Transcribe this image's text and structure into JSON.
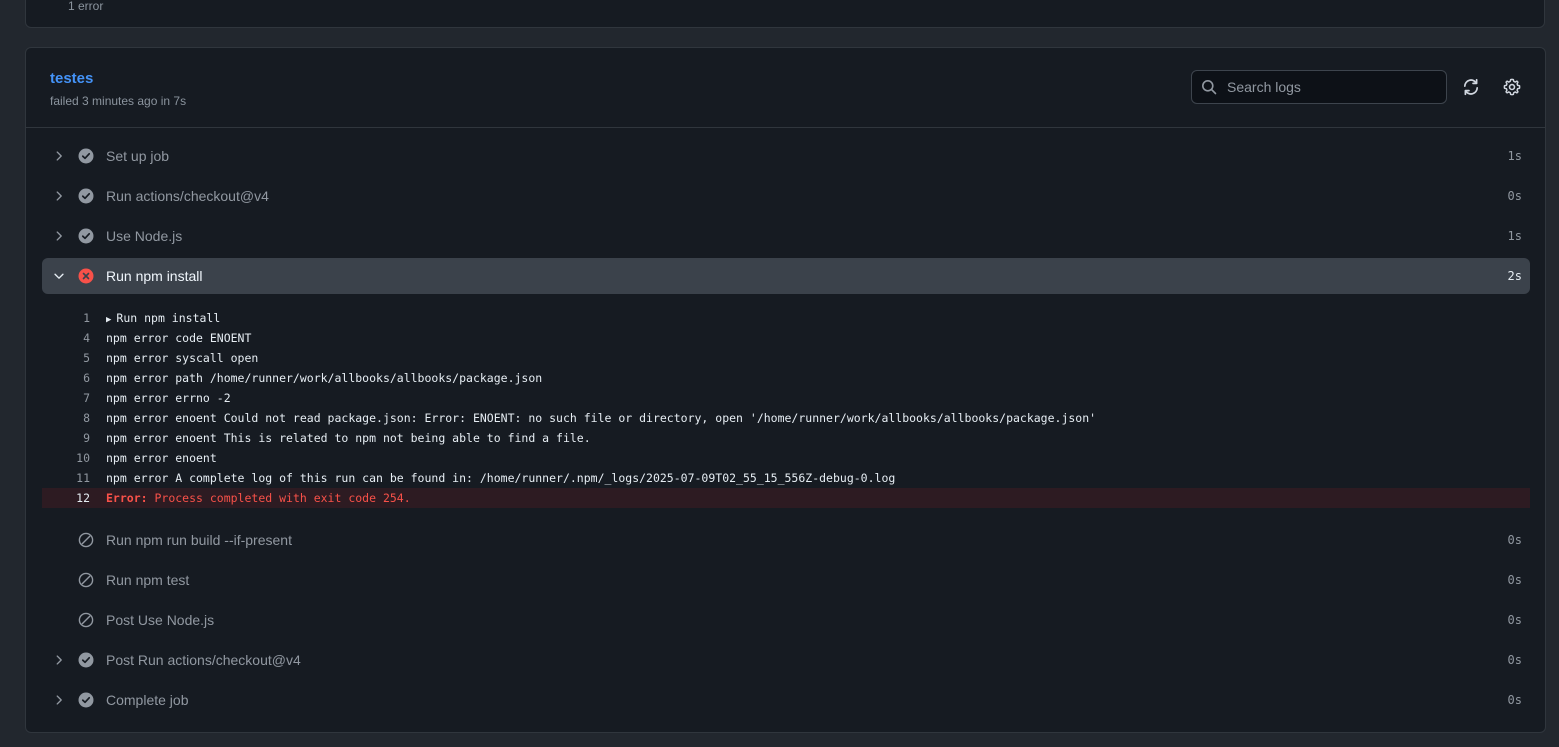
{
  "top_card": {
    "status_text": "1 error"
  },
  "job": {
    "title": "testes",
    "subtitle": "failed 3 minutes ago in 7s",
    "search_placeholder": "Search logs"
  },
  "steps_before": [
    {
      "name": "Set up job",
      "duration": "1s",
      "status": "success",
      "expandable": true
    },
    {
      "name": "Run actions/checkout@v4",
      "duration": "0s",
      "status": "success",
      "expandable": true
    },
    {
      "name": "Use Node.js",
      "duration": "1s",
      "status": "success",
      "expandable": true
    }
  ],
  "expanded_step": {
    "name": "Run npm install",
    "duration": "2s",
    "status": "failure"
  },
  "log_lines": [
    {
      "num": "1",
      "text": "Run npm install",
      "group": true
    },
    {
      "num": "4",
      "text": "npm error code ENOENT"
    },
    {
      "num": "5",
      "text": "npm error syscall open"
    },
    {
      "num": "6",
      "text": "npm error path /home/runner/work/allbooks/allbooks/package.json"
    },
    {
      "num": "7",
      "text": "npm error errno -2"
    },
    {
      "num": "8",
      "text": "npm error enoent Could not read package.json: Error: ENOENT: no such file or directory, open '/home/runner/work/allbooks/allbooks/package.json'"
    },
    {
      "num": "9",
      "text": "npm error enoent This is related to npm not being able to find a file."
    },
    {
      "num": "10",
      "text": "npm error enoent"
    },
    {
      "num": "11",
      "text": "npm error A complete log of this run can be found in: /home/runner/.npm/_logs/2025-07-09T02_55_15_556Z-debug-0.log"
    }
  ],
  "error_line": {
    "num": "12",
    "label": "Error:",
    "text": " Process completed with exit code 254."
  },
  "steps_after": [
    {
      "name": "Run npm run build --if-present",
      "duration": "0s",
      "status": "skipped",
      "expandable": false
    },
    {
      "name": "Run npm test",
      "duration": "0s",
      "status": "skipped",
      "expandable": false
    },
    {
      "name": "Post Use Node.js",
      "duration": "0s",
      "status": "skipped",
      "expandable": false
    },
    {
      "name": "Post Run actions/checkout@v4",
      "duration": "0s",
      "status": "success",
      "expandable": true
    },
    {
      "name": "Complete job",
      "duration": "0s",
      "status": "success",
      "expandable": true
    }
  ],
  "colors": {
    "link": "#4493f8",
    "error": "#f85149",
    "success_icon": "#9198a1"
  }
}
